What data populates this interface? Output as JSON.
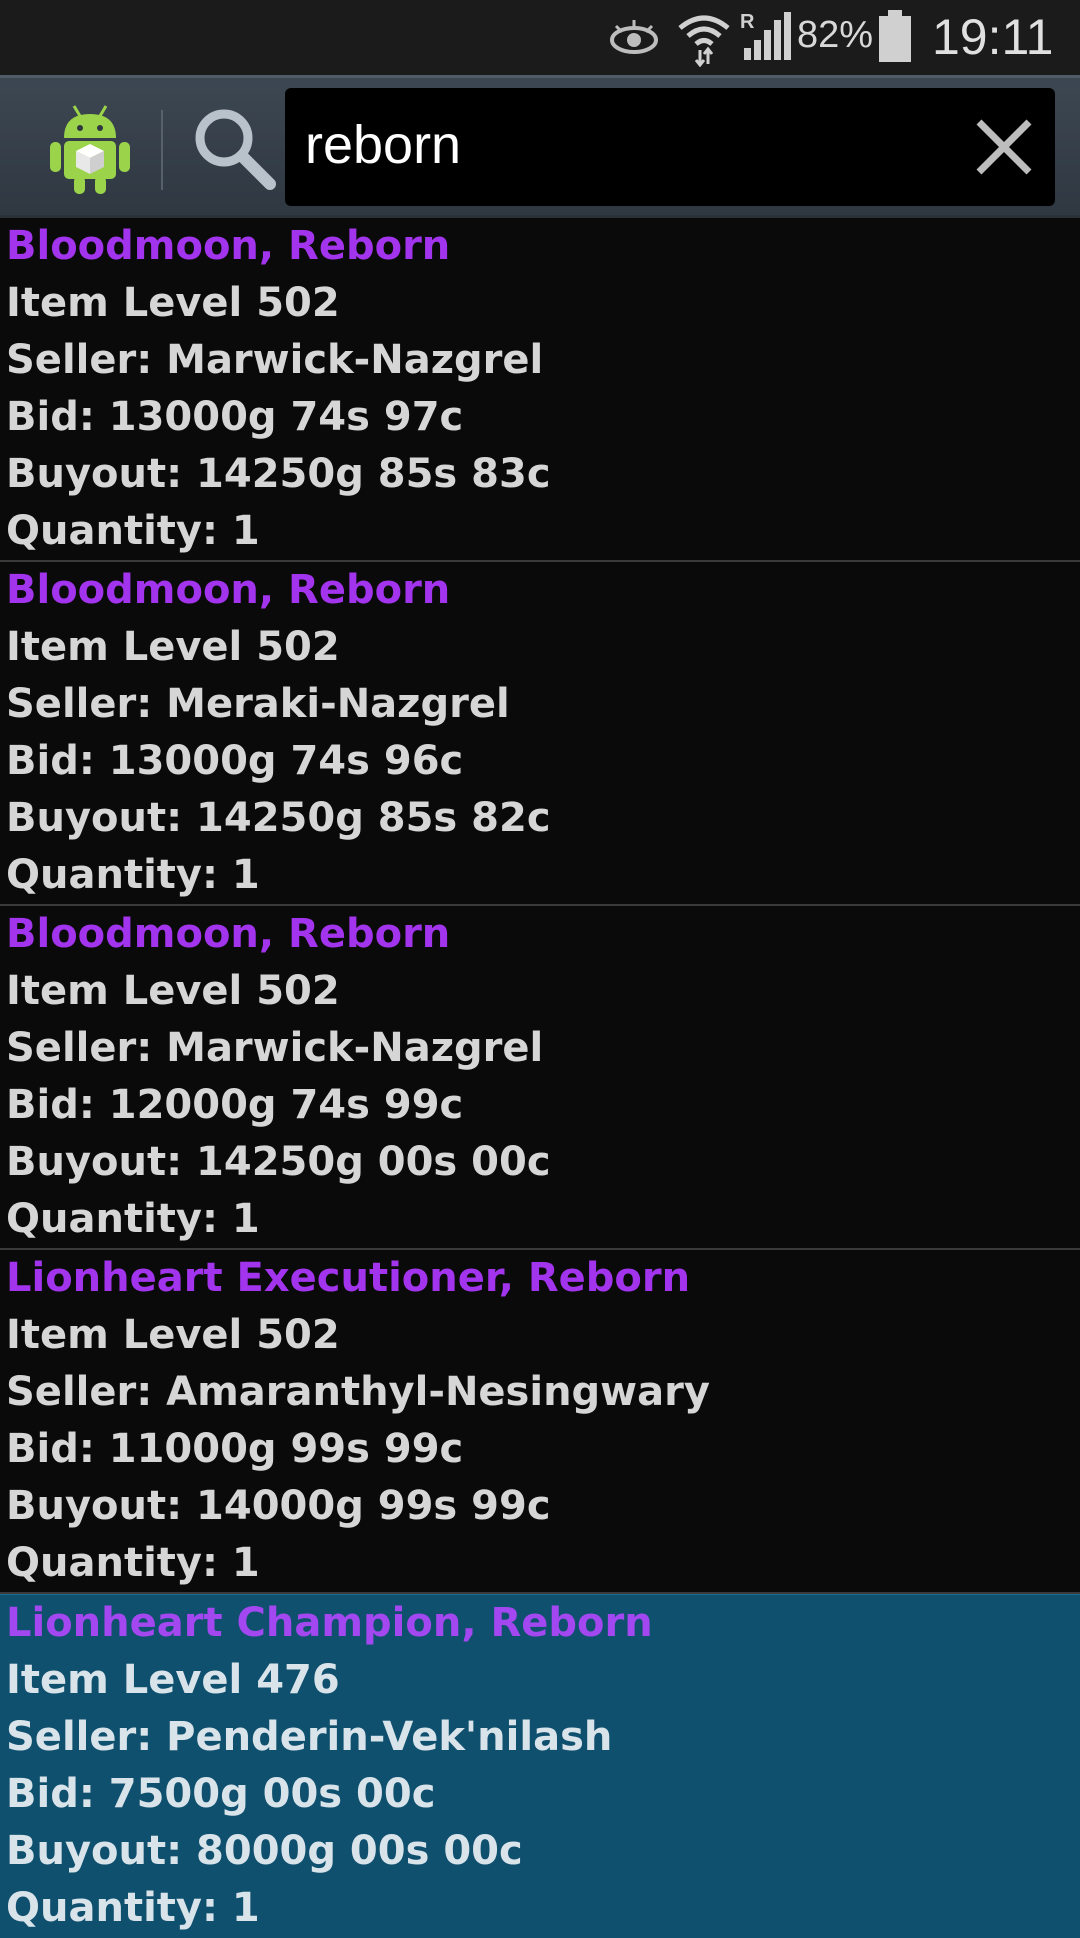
{
  "status_bar": {
    "battery_percent": "82%",
    "time": "19:11",
    "icons": [
      "eye-icon",
      "wifi-icon",
      "signal-roaming-icon",
      "battery-icon"
    ]
  },
  "search": {
    "query": "reborn",
    "icon": "search-icon",
    "clear_icon": "close-icon"
  },
  "app": {
    "icon": "android-app-icon"
  },
  "colors": {
    "item_name": "#a334ee",
    "selected_bg": "#10506f",
    "text": "#d6d6d6"
  },
  "results": [
    {
      "name": "Bloodmoon, Reborn",
      "item_level": "Item Level 502",
      "seller": "Seller: Marwick-Nazgrel",
      "bid": "Bid: 13000g 74s 97c",
      "buyout": "Buyout: 14250g 85s 83c",
      "quantity": "Quantity: 1"
    },
    {
      "name": "Bloodmoon, Reborn",
      "item_level": "Item Level 502",
      "seller": "Seller: Meraki-Nazgrel",
      "bid": "Bid: 13000g 74s 96c",
      "buyout": "Buyout: 14250g 85s 82c",
      "quantity": "Quantity: 1"
    },
    {
      "name": "Bloodmoon, Reborn",
      "item_level": "Item Level 502",
      "seller": "Seller: Marwick-Nazgrel",
      "bid": "Bid: 12000g 74s 99c",
      "buyout": "Buyout: 14250g 00s 00c",
      "quantity": "Quantity: 1"
    },
    {
      "name": "Lionheart Executioner, Reborn",
      "item_level": "Item Level 502",
      "seller": "Seller: Amaranthyl-Nesingwary",
      "bid": "Bid: 11000g 99s 99c",
      "buyout": "Buyout: 14000g 99s 99c",
      "quantity": "Quantity: 1"
    },
    {
      "name": "Lionheart Champion, Reborn",
      "item_level": "Item Level 476",
      "seller": "Seller: Penderin-Vek'nilash",
      "bid": "Bid: 7500g 00s 00c",
      "buyout": "Buyout: 8000g 00s 00c",
      "quantity": "Quantity: 1"
    }
  ]
}
